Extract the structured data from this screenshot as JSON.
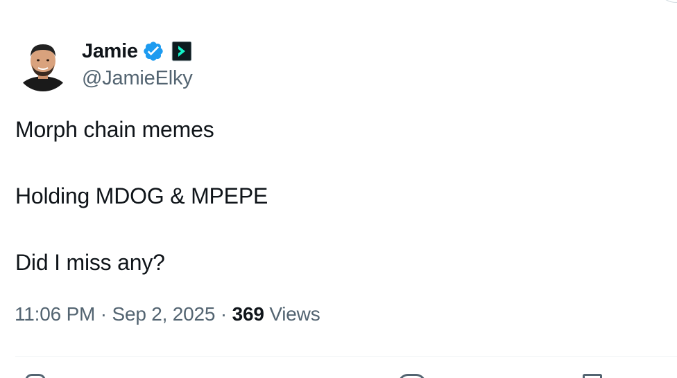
{
  "author": {
    "display_name": "Jamie",
    "handle": "@JamieElky",
    "verified_badge_icon": "verified-check-icon",
    "affiliate_badge_icon": "chevron-right-badge-icon",
    "verified_color": "#1d9bf0"
  },
  "tweet": {
    "lines": [
      "Morph chain memes",
      "Holding MDOG & MPEPE",
      "Did I miss any?"
    ]
  },
  "meta": {
    "time": "11:06 PM",
    "separator": " · ",
    "date": "Sep 2, 2025",
    "views_count": "369",
    "views_label": "Views"
  },
  "actions": [
    "reply-icon",
    "like-icon",
    "bookmark-icon"
  ]
}
